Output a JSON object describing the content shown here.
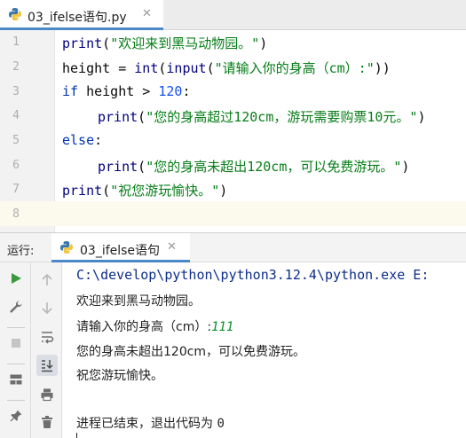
{
  "editor": {
    "tab": {
      "filename": "03_ifelse语句.py",
      "close_glyph": "✕"
    },
    "line_numbers": [
      "1",
      "2",
      "3",
      "4",
      "5",
      "6",
      "7",
      "8"
    ],
    "lines": {
      "l1": {
        "fn": "print",
        "p1": "(",
        "str": "\"欢迎来到黑马动物园。\"",
        "p2": ")"
      },
      "l2": {
        "var": "height = ",
        "fn1": "int",
        "p1": "(",
        "fn2": "input",
        "p2": "(",
        "str": "\"请输入你的身高（cm）:\"",
        "p3": "))"
      },
      "l3": {
        "kw": "if",
        "mid": " height > ",
        "num": "120",
        "end": ":"
      },
      "l4": {
        "fn": "print",
        "p1": "(",
        "str": "\"您的身高超过120cm，游玩需要购票10元。\"",
        "p2": ")"
      },
      "l5": {
        "kw": "else",
        "end": ":"
      },
      "l6": {
        "fn": "print",
        "p1": "(",
        "str": "\"您的身高未超出120cm，可以免费游玩。\"",
        "p2": ")"
      },
      "l7": {
        "fn": "print",
        "p1": "(",
        "str": "\"祝您游玩愉快。\"",
        "p2": ")"
      }
    }
  },
  "run_panel": {
    "label": "运行:",
    "tab": {
      "name": "03_ifelse语句",
      "close_glyph": "✕"
    },
    "toolbar_left": [
      "run-icon",
      "wrench-icon",
      "stop-icon",
      "layout-icon",
      "pin-icon"
    ],
    "toolbar_second": [
      "up-arrow-icon",
      "down-arrow-icon",
      "soft-wrap-icon",
      "scroll-to-end-icon",
      "print-icon",
      "trash-icon"
    ]
  },
  "console": {
    "command": "C:\\develop\\python\\python3.12.4\\python.exe E:",
    "out1": "欢迎来到黑马动物园。",
    "prompt": "请输入你的身高（cm）:",
    "user_input": "111",
    "out2": "您的身高未超出120cm，可以免费游玩。",
    "out3": "祝您游玩愉快。",
    "exit_prefix": "进程已结束，退出代码为 ",
    "exit_code": "0"
  },
  "colors": {
    "accent": "#4a88c7",
    "keyword": "#0033b3",
    "string": "#067d17",
    "number": "#1750eb",
    "run_green": "#3c9a3c"
  }
}
